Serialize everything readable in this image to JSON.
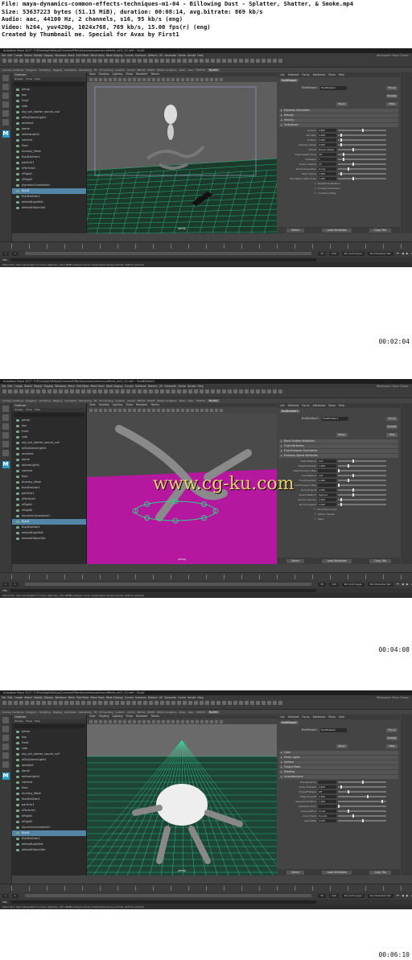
{
  "header": {
    "line1": "File: maya-dynamics-common-effects-techniques-m1-04 - Billowing Dust - Splatter, Shatter, & Smoke.mp4",
    "line2": "Size: 53637223 bytes (51.15 MiB), duration: 00:08:14, avg.bitrate: 869 kb/s",
    "line3": "Audio: aac, 44100 Hz, 2 channels, s16, 95 kb/s (eng)",
    "line4": "Video: h264, yuv420p, 1024x768, 769 kb/s, 15.00 fps(r) (eng)",
    "line5": "Created by Thumbnail me. Special for Avax by First1"
  },
  "frames": [
    {
      "timestamp": "00:02:04",
      "window_title": "Autodesk Maya 2017: F:\\Pluralsight\\Maya\\CommonEffects\\scenes\\common-effects_m01_02.mb*    -    fluid1",
      "attribute_node": "fluidShape1",
      "camera": "persp",
      "sections": [
        "Dynamic Simulation",
        "Density",
        "Velocity",
        "Turbulence"
      ],
      "rows": [
        {
          "label": "Gravity",
          "value": "9.800",
          "p": 0.5
        },
        {
          "label": "Viscosity",
          "value": "0.000",
          "p": 0.05
        },
        {
          "label": "Friction",
          "value": "0.000",
          "p": 0.05
        },
        {
          "label": "Velocity Damp",
          "value": "0.000",
          "p": 0.05
        },
        {
          "label": "Solver",
          "value": "Navier-Stokes",
          "p": 0.3
        },
        {
          "label": "High Detail Solve",
          "value": "Off",
          "p": 0.1
        },
        {
          "label": "Substeps",
          "value": "1",
          "p": 0.1
        },
        {
          "label": "Solver Quality",
          "value": "20",
          "p": 0.3
        },
        {
          "label": "Grid Interpolator",
          "value": "Linear",
          "p": 0.2
        },
        {
          "label": "Start Frame",
          "value": "1.000",
          "p": 0.05
        },
        {
          "label": "Simulation Rate Scale",
          "value": "1.000",
          "p": 0.3
        }
      ],
      "checkboxes": [
        "Disable Evaluation",
        "Forward Advection",
        "Conserve Mass"
      ]
    },
    {
      "timestamp": "00:04:08",
      "window_title": "Autodesk Maya 2017: F:\\Pluralsight\\Maya\\CommonEffects\\scenes\\common-effects_m01_02.mb*    -    fluidEmitter1",
      "attribute_node": "fluidEmitter1",
      "camera": "persp",
      "sections": [
        "Basic Emitter Attributes",
        "Fluid Attributes",
        "Fluid Emission Turbulence",
        "Emission Speed Attributes"
      ],
      "rows": [
        {
          "label": "Heat Method",
          "value": "Add",
          "p": 0.3
        },
        {
          "label": "Heat/Voxel/Sec",
          "value": "1.000",
          "p": 0.2
        },
        {
          "label": "Heat Emission Map",
          "value": "",
          "p": 0.0
        },
        {
          "label": "Fuel Method",
          "value": "Add",
          "p": 0.3
        },
        {
          "label": "Fuel/Voxel/Sec",
          "value": "1.000",
          "p": 0.2
        },
        {
          "label": "Fuel Emission Map",
          "value": "",
          "p": 0.0
        },
        {
          "label": "Fluid Dropoff",
          "value": "2.000",
          "p": 0.3
        },
        {
          "label": "Speed Method",
          "value": "Replace",
          "p": 0.3
        },
        {
          "label": "Inherit Velocity",
          "value": "0.000",
          "p": 0.05
        },
        {
          "label": "Normal Speed",
          "value": "0.000",
          "p": 0.05
        }
      ],
      "checkboxes": [
        "Emit Fluid Color",
        "Motion Streak",
        "Jitter"
      ]
    },
    {
      "timestamp": "00:06:10",
      "window_title": "Autodesk Maya 2017: F:\\Pluralsight\\Maya\\CommonEffects\\scenes\\common-effects_m01_02.mb*    -    fluid1",
      "attribute_node": "fluidShape1",
      "camera": "persp",
      "sections": [
        "Color",
        "Emits Lights",
        "Surface",
        "Output Mesh",
        "Shading",
        "Incandescence"
      ],
      "rows": [
        {
          "label": "Transparency",
          "value": "",
          "p": 0.5
        },
        {
          "label": "Glow Intensity",
          "value": "0.000",
          "p": 0.05
        },
        {
          "label": "Dropoff Shape",
          "value": "Off",
          "p": 0.2
        },
        {
          "label": "Edge Dropoff",
          "value": "0.600",
          "p": 0.6
        },
        {
          "label": "Selected Position",
          "value": "1.000",
          "p": 0.9
        },
        {
          "label": "Selected Color",
          "value": "",
          "p": 0.0
        },
        {
          "label": "Interpolation",
          "value": "Linear",
          "p": 0.2
        },
        {
          "label": "Color Input",
          "value": "Density",
          "p": 0.3
        },
        {
          "label": "Input Bias",
          "value": "0.000",
          "p": 0.5
        }
      ],
      "checkboxes": []
    }
  ],
  "menu": [
    "File",
    "Edit",
    "Create",
    "Select",
    "Modify",
    "Display",
    "Windows",
    "Mesh",
    "Edit Mesh",
    "Mesh Tools",
    "Mesh Display",
    "Curves",
    "Surfaces",
    "Deform",
    "UV",
    "Generate",
    "Cache",
    "Arnold",
    "Help"
  ],
  "menu_right": "Workspace: Maya Classic",
  "shelf_tabs": [
    "Curves / Surfaces",
    "Polygons",
    "Sculpting",
    "Rigging",
    "Animation",
    "Rendering",
    "FX",
    "FX Caching",
    "Custom",
    "Arnold",
    "Bifrost",
    "MASH",
    "Motion Graphics",
    "XGen",
    "User",
    "TURTLE"
  ],
  "shelf_active": "FluidFX",
  "outliner": {
    "title": "Outliner",
    "menu": [
      "Display",
      "Show",
      "Help"
    ],
    "items": [
      "persp",
      "top",
      "front",
      "side",
      "sky_sdr_starter_sound_null",
      "aiSkyDomeLight1",
      "ambient",
      "dome",
      "aiAreaLight1",
      "camera",
      "floor",
      "dummy_Mesh",
      "fluidEmitter1",
      "particle1",
      "nParticle1",
      "nRigid1",
      "nRigid2",
      "dynamicConstraint1",
      "fluid1",
      "fluidEmitter1",
      "defaultLightSet",
      "defaultObjectSet"
    ],
    "selected_index": 18
  },
  "viewport_menu": [
    "View",
    "Shading",
    "Lighting",
    "Show",
    "Renderer",
    "Panels"
  ],
  "attr_tabs": [
    "List",
    "Selected",
    "Focus",
    "Attributes",
    "Show",
    "Help"
  ],
  "attr_buttons": {
    "focus": "Focus",
    "presets": "Presets",
    "show": "Show",
    "hide": "Hide"
  },
  "attr_bottom": [
    "Select",
    "Load Attributes",
    "Copy Tab"
  ],
  "range": {
    "start": "1",
    "end": "70",
    "end2": "120",
    "anim": "No Anim Layer",
    "char": "No Character Set"
  },
  "mel_label": "MEL",
  "help_text": "Move Tool: Use manipulator to move object(s). Ctrl+MMB+drag to move components along normals. Shift to extrude.",
  "watermark": "www.cg-ku.com"
}
